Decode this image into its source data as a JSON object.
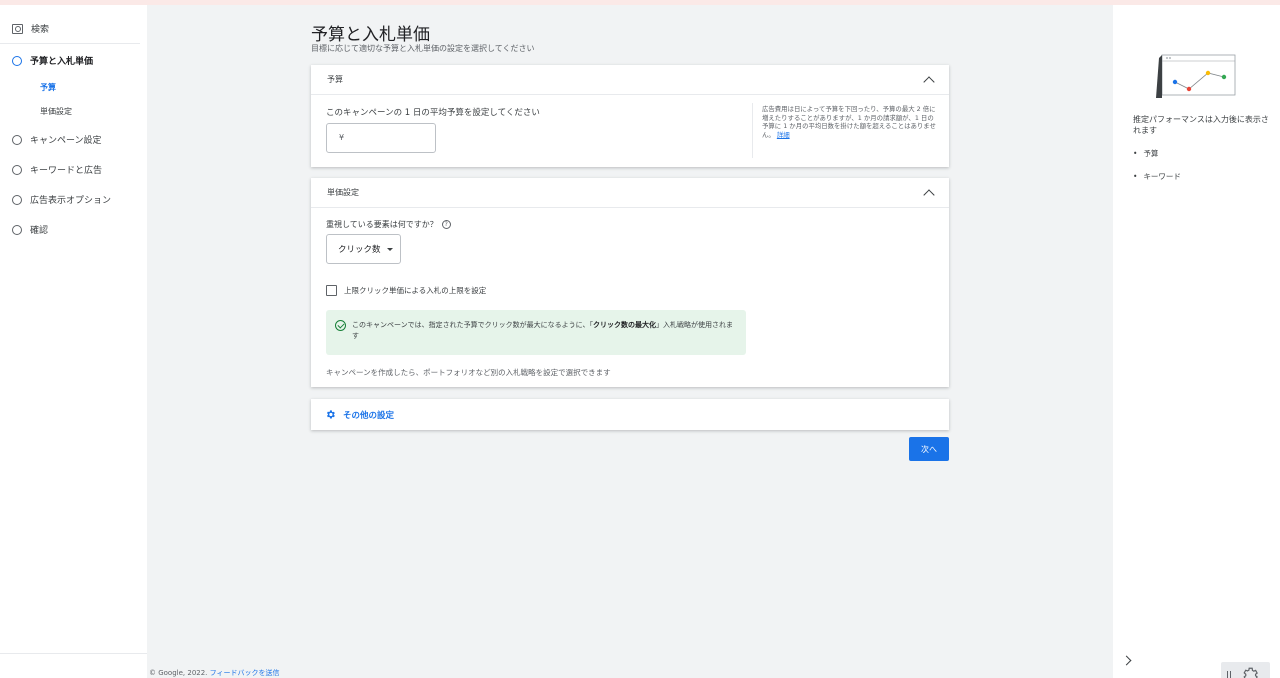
{
  "sidebar": {
    "search_label": "検索",
    "steps": [
      {
        "label": "予算と入札単価",
        "active": true
      },
      {
        "label": "キャンペーン設定"
      },
      {
        "label": "キーワードと広告"
      },
      {
        "label": "広告表示オプション"
      },
      {
        "label": "確認"
      }
    ],
    "substeps": [
      {
        "label": "予算",
        "active": true
      },
      {
        "label": "単価設定"
      }
    ]
  },
  "main": {
    "title": "予算と入札単価",
    "subtitle": "目標に応じて適切な予算と入札単価の設定を選択してください",
    "budget": {
      "header": "予算",
      "question": "このキャンペーンの 1 日の平均予算を設定してください",
      "input_prefix": "¥",
      "note": "広告費用は日によって予算を下回ったり、予算の最大 2 倍に増えたりすることがありますが、1 か月の請求額が、1 日の予算に 1 か月の平均日数を掛けた額を超えることはありません。",
      "note_link": "詳細"
    },
    "bidding": {
      "header": "単価設定",
      "question": "重視している要素は何ですか？",
      "help": "?",
      "selected": "クリック数",
      "checkbox_label": "上限クリック単価による入札の上限を設定",
      "info_pre": "このキャンペーンでは、指定された予算でクリック数が最大になるように、「",
      "info_bold": "クリック数の最大化",
      "info_post": "」入札戦略が使用されます",
      "footnote": "キャンペーンを作成したら、ポートフォリオなど別の入札戦略を設定で選択できます"
    },
    "other_settings": "その他の設定",
    "next_button": "次へ"
  },
  "footer": {
    "copyright": "© Google, 2022.",
    "feedback_link": "フィードバックを送信"
  },
  "right_panel": {
    "estimate_text": "推定パフォーマンスは入力後に表示されます",
    "items": [
      "予算",
      "キーワード"
    ]
  },
  "colors": {
    "accent": "#1a73e8",
    "success_bg": "#e6f4ea",
    "success": "#188038"
  }
}
